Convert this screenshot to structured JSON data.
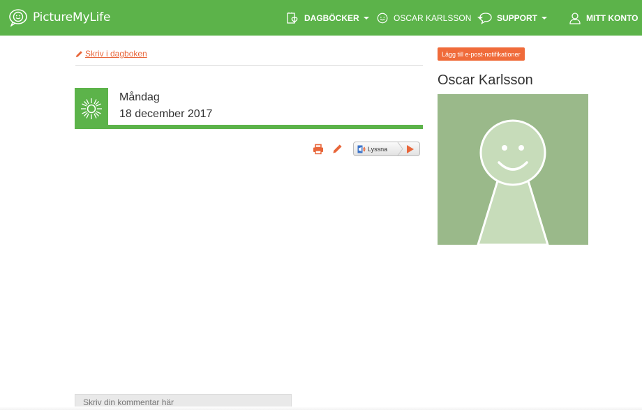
{
  "brand": {
    "name": "PictureMyLife"
  },
  "nav": {
    "diaries": "DAGBÖCKER",
    "user": "OSCAR KARLSSON",
    "support": "SUPPORT",
    "account": "MITT KONTO"
  },
  "diary": {
    "write_link": "Skriv i dagboken",
    "weekday": "Måndag",
    "date": "18 december 2017",
    "listen_label": "Lyssna"
  },
  "profile": {
    "notify_button": "Lägg till e-post-notifikationer",
    "name": "Oscar Karlsson"
  },
  "comment": {
    "placeholder": "Skriv din kommentar här"
  },
  "colors": {
    "brand_green": "#5cb34a",
    "accent_orange": "#e8663a",
    "avatar_bg": "#9ab98a"
  },
  "icons": [
    "logo-icon",
    "diary-icon",
    "smiley-icon",
    "speech-bubble-icon",
    "user-icon",
    "pencil-icon",
    "sun-icon",
    "print-icon",
    "speaker-icon",
    "play-icon"
  ]
}
